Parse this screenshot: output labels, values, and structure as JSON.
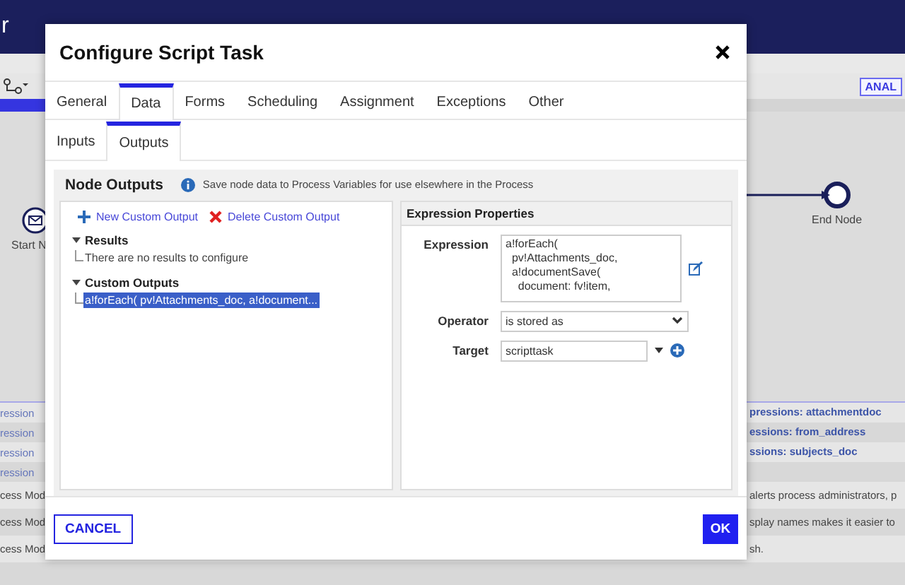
{
  "app": {
    "header_text": "r",
    "toolbar_button": "ANAL"
  },
  "canvas": {
    "nodes": [
      {
        "kind": "start",
        "label": "Start N"
      },
      {
        "kind": "end",
        "label": "End Node"
      }
    ]
  },
  "background_rows": [
    {
      "kind": "link",
      "left": "ression",
      "right": "pressions: attachmentdoc"
    },
    {
      "kind": "link",
      "left": "ression",
      "right": "essions: from_address"
    },
    {
      "kind": "link",
      "left": "ression",
      "right": "ssions: subjects_doc"
    },
    {
      "kind": "link",
      "left": "ression"
    },
    {
      "kind": "text",
      "left": "cess Mod",
      "right": "alerts process administrators, p"
    },
    {
      "kind": "text",
      "left": "cess Mod",
      "right": "splay names makes it easier to"
    },
    {
      "kind": "text",
      "left": "cess Mod",
      "right": "sh."
    }
  ],
  "dialog": {
    "title": "Configure Script Task",
    "tabs": [
      {
        "label": "General",
        "selected": false
      },
      {
        "label": "Data",
        "selected": true
      },
      {
        "label": "Forms",
        "selected": false
      },
      {
        "label": "Scheduling",
        "selected": false
      },
      {
        "label": "Assignment",
        "selected": false
      },
      {
        "label": "Exceptions",
        "selected": false
      },
      {
        "label": "Other",
        "selected": false
      }
    ],
    "subtabs": [
      {
        "label": "Inputs",
        "selected": false
      },
      {
        "label": "Outputs",
        "selected": true
      }
    ],
    "panel": {
      "title": "Node Outputs",
      "info": "Save node data to Process Variables for use elsewhere in the Process",
      "actions": [
        {
          "kind": "add",
          "label": "New Custom Output"
        },
        {
          "kind": "delete",
          "label": "Delete Custom Output"
        }
      ],
      "sections": [
        {
          "title": "Results",
          "expanded": true,
          "children": [
            {
              "label": "There are no results to configure",
              "selected": false
            }
          ]
        },
        {
          "title": "Custom Outputs",
          "expanded": true,
          "children": [
            {
              "label": "a!forEach( pv!Attachments_doc, a!document...",
              "selected": true
            }
          ]
        }
      ],
      "properties": {
        "title": "Expression Properties",
        "expression_label": "Expression",
        "expression": "a!forEach(\n  pv!Attachments_doc,\n  a!documentSave(\n    document: fv!item,",
        "operator_label": "Operator",
        "operator": "is stored as",
        "target_label": "Target",
        "target": "scripttask"
      }
    },
    "buttons": [
      {
        "kind": "secondary",
        "label": "CANCEL"
      },
      {
        "kind": "primary",
        "label": "OK"
      }
    ]
  }
}
